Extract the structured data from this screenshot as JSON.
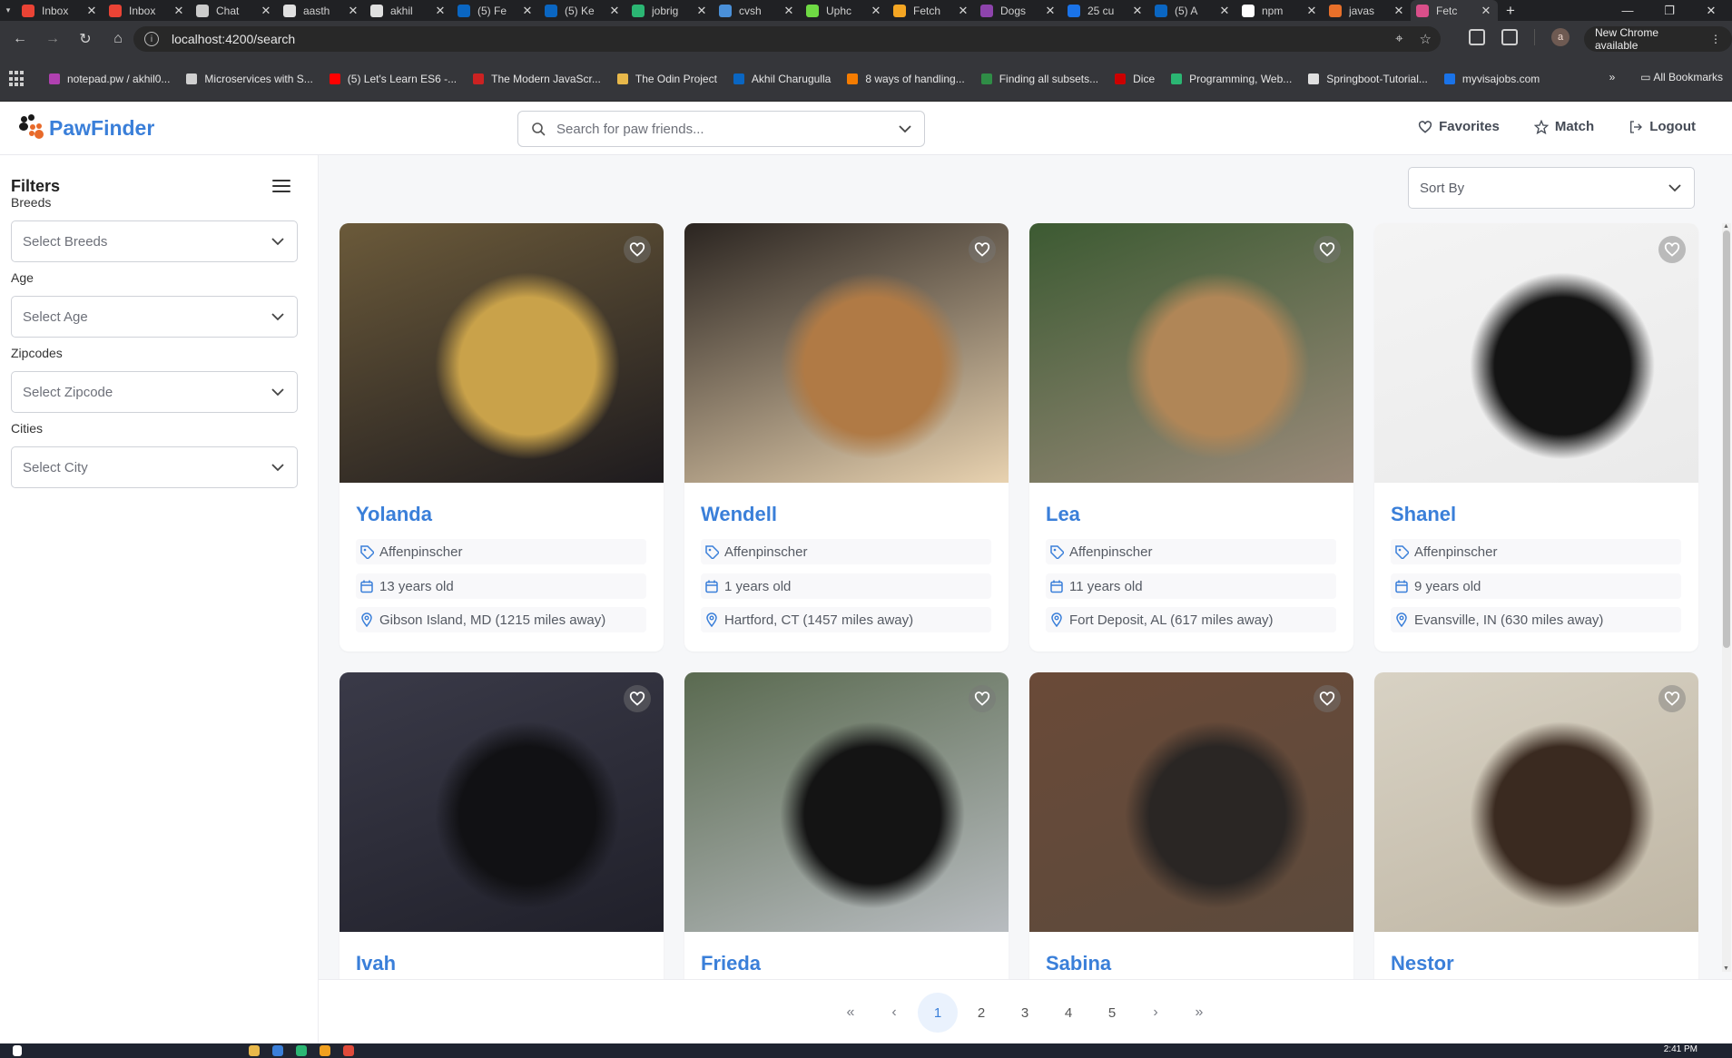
{
  "browser": {
    "tabs": [
      {
        "title": "Inbox",
        "color": "#ea4335"
      },
      {
        "title": "Inbox",
        "color": "#ea4335"
      },
      {
        "title": "Chat",
        "color": "#cccccc"
      },
      {
        "title": "aasth",
        "color": "#e0e0e0"
      },
      {
        "title": "akhil",
        "color": "#e0e0e0"
      },
      {
        "title": "(5) Fe",
        "color": "#0a66c2"
      },
      {
        "title": "(5) Ke",
        "color": "#0a66c2"
      },
      {
        "title": "jobrig",
        "color": "#2bb673"
      },
      {
        "title": "cvsh",
        "color": "#4a90d9"
      },
      {
        "title": "Uphc",
        "color": "#6fda44"
      },
      {
        "title": "Fetch",
        "color": "#f5a623"
      },
      {
        "title": "Dogs",
        "color": "#8e44ad"
      },
      {
        "title": "25 cu",
        "color": "#1a73e8"
      },
      {
        "title": "(5) A",
        "color": "#0a66c2"
      },
      {
        "title": "npm",
        "color": "#ffffff"
      },
      {
        "title": "javas",
        "color": "#e8702a"
      },
      {
        "title": "Fetc",
        "color": "#d94f8a"
      }
    ],
    "url": "localhost:4200/search",
    "new_chrome_label": "New Chrome available",
    "profile_initial": "a",
    "bookmarks": [
      {
        "label": "notepad.pw / akhil0...",
        "color": "#b040b0"
      },
      {
        "label": "Microservices with S...",
        "color": "#d0d0d0"
      },
      {
        "label": "(5) Let's Learn ES6 -...",
        "color": "#ff0000"
      },
      {
        "label": "The Modern JavaScr...",
        "color": "#cc2222"
      },
      {
        "label": "The Odin Project",
        "color": "#e8b84a"
      },
      {
        "label": "Akhil Charugulla",
        "color": "#0a66c2"
      },
      {
        "label": "8 ways of handling...",
        "color": "#f57c00"
      },
      {
        "label": "Finding all subsets...",
        "color": "#2f8d46"
      },
      {
        "label": "Dice",
        "color": "#cc0000"
      },
      {
        "label": "Programming, Web...",
        "color": "#2bb673"
      },
      {
        "label": "Springboot-Tutorial...",
        "color": "#e0e0e0"
      },
      {
        "label": "myvisajobs.com",
        "color": "#1a73e8"
      }
    ],
    "all_bookmarks_label": "All Bookmarks",
    "overflow_label": "»"
  },
  "app": {
    "brand": "PawFinder",
    "search_placeholder": "Search for paw friends...",
    "nav": {
      "favorites": "Favorites",
      "match": "Match",
      "logout": "Logout"
    }
  },
  "sidebar": {
    "title": "Filters",
    "filters": [
      {
        "label": "Breeds",
        "placeholder": "Select Breeds"
      },
      {
        "label": "Age",
        "placeholder": "Select Age"
      },
      {
        "label": "Zipcodes",
        "placeholder": "Select Zipcode"
      },
      {
        "label": "Cities",
        "placeholder": "Select City"
      }
    ]
  },
  "sort": {
    "label": "Sort By"
  },
  "dogs": [
    {
      "name": "Yolanda",
      "breed": "Affenpinscher",
      "age": "13 years old",
      "location": "Gibson Island, MD (1215 miles away)",
      "photo_colors": [
        "#6b5a3a",
        "#c9a24a",
        "#1e1b1e"
      ]
    },
    {
      "name": "Wendell",
      "breed": "Affenpinscher",
      "age": "1 years old",
      "location": "Hartford, CT (1457 miles away)",
      "photo_colors": [
        "#2a2420",
        "#b07a45",
        "#e8d2b0"
      ]
    },
    {
      "name": "Lea",
      "breed": "Affenpinscher",
      "age": "11 years old",
      "location": "Fort Deposit, AL (617 miles away)",
      "photo_colors": [
        "#3c5a32",
        "#b08657",
        "#9a8a7a"
      ]
    },
    {
      "name": "Shanel",
      "breed": "Affenpinscher",
      "age": "9 years old",
      "location": "Evansville, IN (630 miles away)",
      "photo_colors": [
        "#f4f4f4",
        "#141414",
        "#eaeaea"
      ]
    },
    {
      "name": "Ivah",
      "breed": "",
      "age": "",
      "location": "",
      "photo_colors": [
        "#3a3a48",
        "#111114",
        "#20202a"
      ]
    },
    {
      "name": "Frieda",
      "breed": "",
      "age": "",
      "location": "",
      "photo_colors": [
        "#5a6a50",
        "#141414",
        "#b8bcc0"
      ]
    },
    {
      "name": "Sabina",
      "breed": "",
      "age": "",
      "location": "",
      "photo_colors": [
        "#6a4a38",
        "#2a2624",
        "#5c4a3c"
      ]
    },
    {
      "name": "Nestor",
      "breed": "",
      "age": "",
      "location": "",
      "photo_colors": [
        "#d8d2c4",
        "#3a2a20",
        "#bfb6a4"
      ]
    }
  ],
  "pagination": {
    "first": "«",
    "prev": "‹",
    "pages": [
      "1",
      "2",
      "3",
      "4",
      "5"
    ],
    "current": "1",
    "next": "›",
    "last": "»"
  },
  "taskbar": {
    "clock": "2:41 PM"
  },
  "colors": {
    "accent": "#3a7fd9",
    "page_bg": "#f6f7f9",
    "chrome_dark": "#35363a"
  }
}
